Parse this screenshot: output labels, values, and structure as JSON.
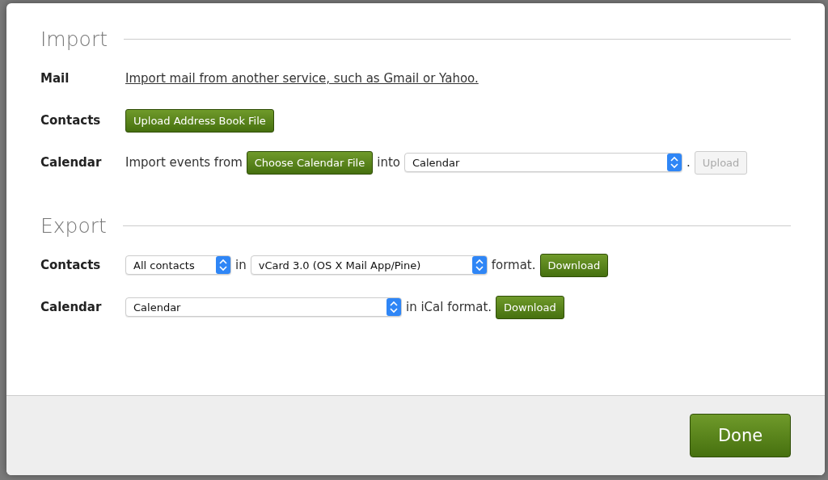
{
  "dialog": {
    "sections": [
      {
        "title": "Import",
        "rows": [
          {
            "label": "Mail",
            "parts": [
              {
                "kind": "link",
                "text": "Import mail from another service, such as Gmail or Yahoo."
              }
            ]
          },
          {
            "label": "Contacts",
            "parts": [
              {
                "kind": "button",
                "text": "Upload Address Book File",
                "disabled": false
              }
            ]
          },
          {
            "label": "Calendar",
            "parts": [
              {
                "kind": "text",
                "text": "Import events from"
              },
              {
                "kind": "button",
                "text": "Choose Calendar File",
                "disabled": false
              },
              {
                "kind": "text",
                "text": "into"
              },
              {
                "kind": "select",
                "value": "Calendar"
              },
              {
                "kind": "text",
                "text": "."
              },
              {
                "kind": "button",
                "text": "Upload",
                "disabled": true
              }
            ]
          }
        ]
      },
      {
        "title": "Export",
        "rows": [
          {
            "label": "Contacts",
            "parts": [
              {
                "kind": "select",
                "value": "All contacts"
              },
              {
                "kind": "text",
                "text": "in"
              },
              {
                "kind": "select",
                "value": "vCard 3.0 (OS X Mail App/Pine)"
              },
              {
                "kind": "text",
                "text": "format."
              },
              {
                "kind": "button",
                "text": "Download",
                "disabled": false
              }
            ]
          },
          {
            "label": "Calendar",
            "parts": [
              {
                "kind": "select",
                "value": "Calendar"
              },
              {
                "kind": "text",
                "text": "in iCal format."
              },
              {
                "kind": "button",
                "text": "Download",
                "disabled": false
              }
            ]
          }
        ]
      }
    ],
    "done_button": "Done"
  }
}
